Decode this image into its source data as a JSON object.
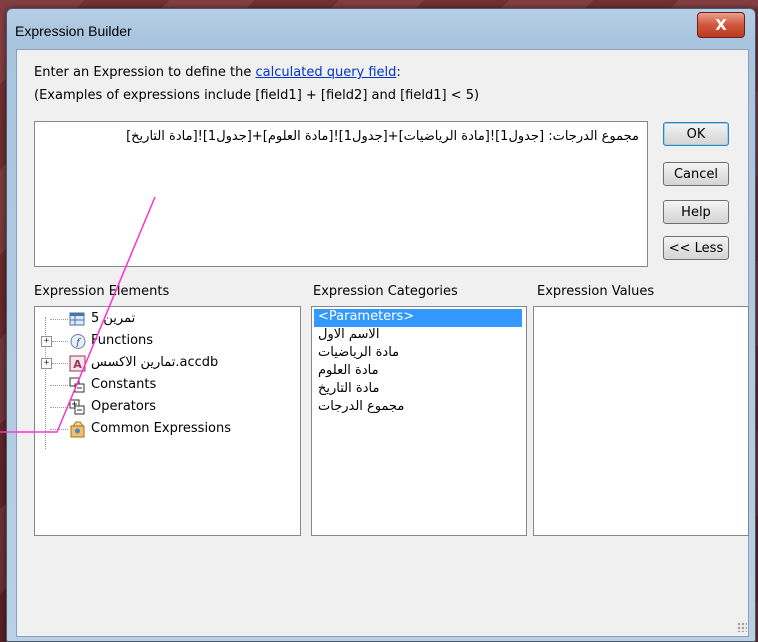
{
  "window": {
    "title": "Expression Builder",
    "close_label": "X"
  },
  "prompt": {
    "line1_before": "Enter an Expression to define the ",
    "line1_link": "calculated query field",
    "line1_after": ":",
    "line2": "(Examples of expressions include [field1] + [field2] and [field1] < 5)"
  },
  "expression": {
    "value": "مجموع الدرجات: [جدول1]![مادة الرياضيات]+[جدول1]![مادة العلوم]+[جدول1]![مادة التاريخ]"
  },
  "buttons": {
    "ok": "OK",
    "cancel": "Cancel",
    "help": "Help",
    "less": "<< Less"
  },
  "panels": {
    "elements_label": "Expression Elements",
    "categories_label": "Expression Categories",
    "values_label": "Expression Values"
  },
  "elements": [
    {
      "label": "تمرين 5",
      "icon": "query-icon",
      "expander": ""
    },
    {
      "label": "Functions",
      "icon": "functions-icon",
      "expander": "+"
    },
    {
      "label": "تمارين الاكسس.accdb",
      "icon": "database-icon",
      "expander": "+"
    },
    {
      "label": "Constants",
      "icon": "constants-icon",
      "expander": ""
    },
    {
      "label": "Operators",
      "icon": "operators-icon",
      "expander": ""
    },
    {
      "label": "Common Expressions",
      "icon": "common-expressions-icon",
      "expander": ""
    }
  ],
  "categories": [
    {
      "label": "<Parameters>",
      "selected": true
    },
    {
      "label": "الاسم الاول",
      "selected": false
    },
    {
      "label": "مادة الرياضيات",
      "selected": false
    },
    {
      "label": "مادة العلوم",
      "selected": false
    },
    {
      "label": "مادة التاريخ",
      "selected": false
    },
    {
      "label": "مجموع الدرجات",
      "selected": false
    }
  ],
  "colors": {
    "selection": "#3399ff",
    "link": "#0033cc",
    "annotation": "#ff33cc"
  }
}
